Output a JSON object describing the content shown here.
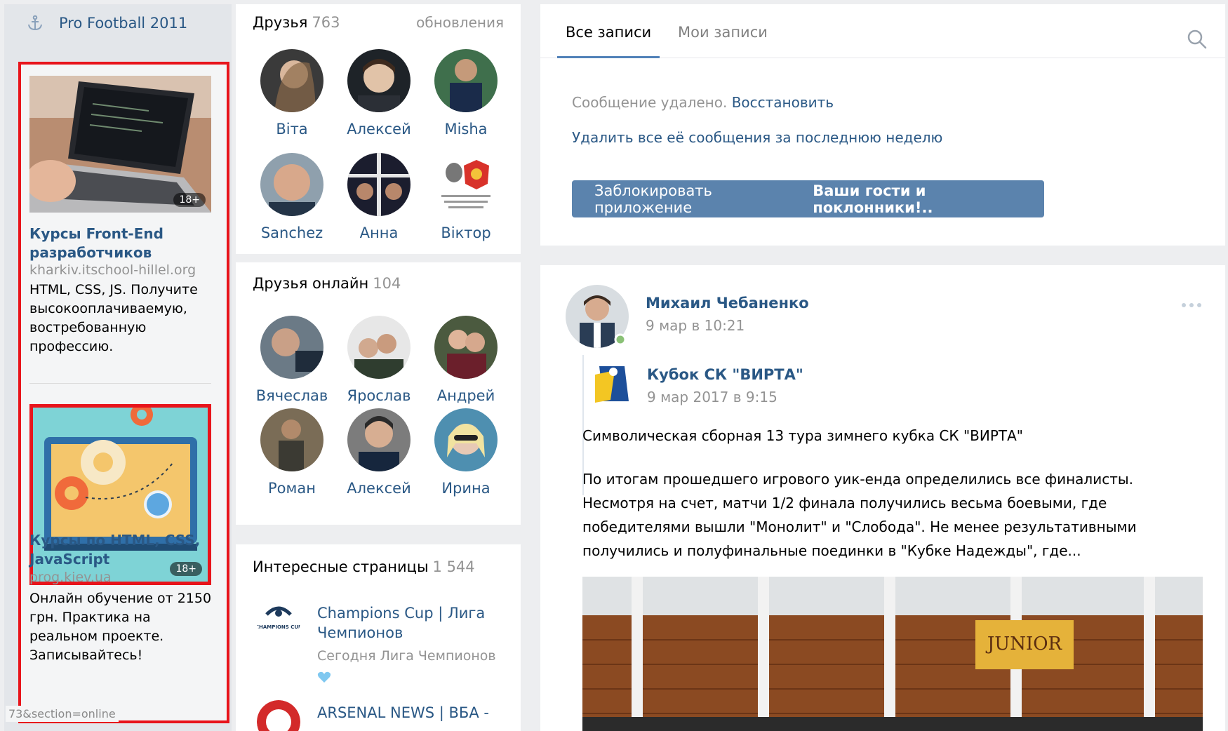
{
  "left": {
    "group_link": "Pro Football 2011",
    "ads": [
      {
        "title": "Курсы Front-End разработчиков",
        "domain": "kharkiv.itschool-hillel.org",
        "text": "HTML, CSS, JS. Получите высокооплачиваемую, востребованную профессию.",
        "badge": "18+"
      },
      {
        "title": "Курсы по HTML, CSS, JavaScript",
        "domain": "prog.kiev.ua",
        "text": "Онлайн обучение от 2150 грн. Практика на реальном проекте. Записывайтесь!",
        "badge": "18+"
      }
    ],
    "status_url": "73&section=online"
  },
  "friends": {
    "title": "Друзья",
    "count": "763",
    "updates_label": "обновления",
    "items": [
      "Віта",
      "Алексей",
      "Misha",
      "Sanchez",
      "Анна",
      "Віктор"
    ]
  },
  "online": {
    "title": "Друзья онлайн",
    "count": "104",
    "items": [
      "Вячеслав",
      "Ярослав",
      "Андрей",
      "Роман",
      "Алексей",
      "Ирина"
    ]
  },
  "pages": {
    "title": "Интересные страницы",
    "count": "1 544",
    "items": [
      {
        "name": "Champions Cup | Лига Чемпионов",
        "status": "Сегодня Лига Чемпионов",
        "logo_text": "CHAMPIONS CUP"
      },
      {
        "name": "ARSENAL NEWS | ВБА -",
        "status": ""
      }
    ]
  },
  "wall": {
    "tabs": [
      "Все записи",
      "Мои записи"
    ],
    "deleted_text": "Сообщение удалено.",
    "restore_link": "Восстановить",
    "delete_week_link": "Удалить все её сообщения за последнюю неделю",
    "block_prefix": "Заблокировать приложение ",
    "block_app": "Ваши гости и поклонники!.."
  },
  "post": {
    "author": "Михаил Чебаненко",
    "time": "9 мар в 10:21",
    "repost_author": "Кубок СК \"ВИРТА\"",
    "repost_time": "9 мар 2017 в 9:15",
    "text_title": "Символическая сборная 13 тура зимнего кубка СК \"ВИРТА\"",
    "text_lines": [
      "По итогам прошедшего игрового уик-енда определились все финалисты.",
      "Несмотря на счет, матчи 1/2 финала получились весьма боевыми, где",
      "победителями вышли \"Монолит\" и \"Слобода\". Не менее результативными",
      "получились и полуфинальные поединки в \"Кубке Надежды\", где..."
    ],
    "photo_sign": "JUNIOR"
  },
  "colors": {
    "link": "#2a5885",
    "muted": "#939393",
    "accent": "#5181b8",
    "highlight": "#e8141b",
    "button": "#5b83ad"
  }
}
